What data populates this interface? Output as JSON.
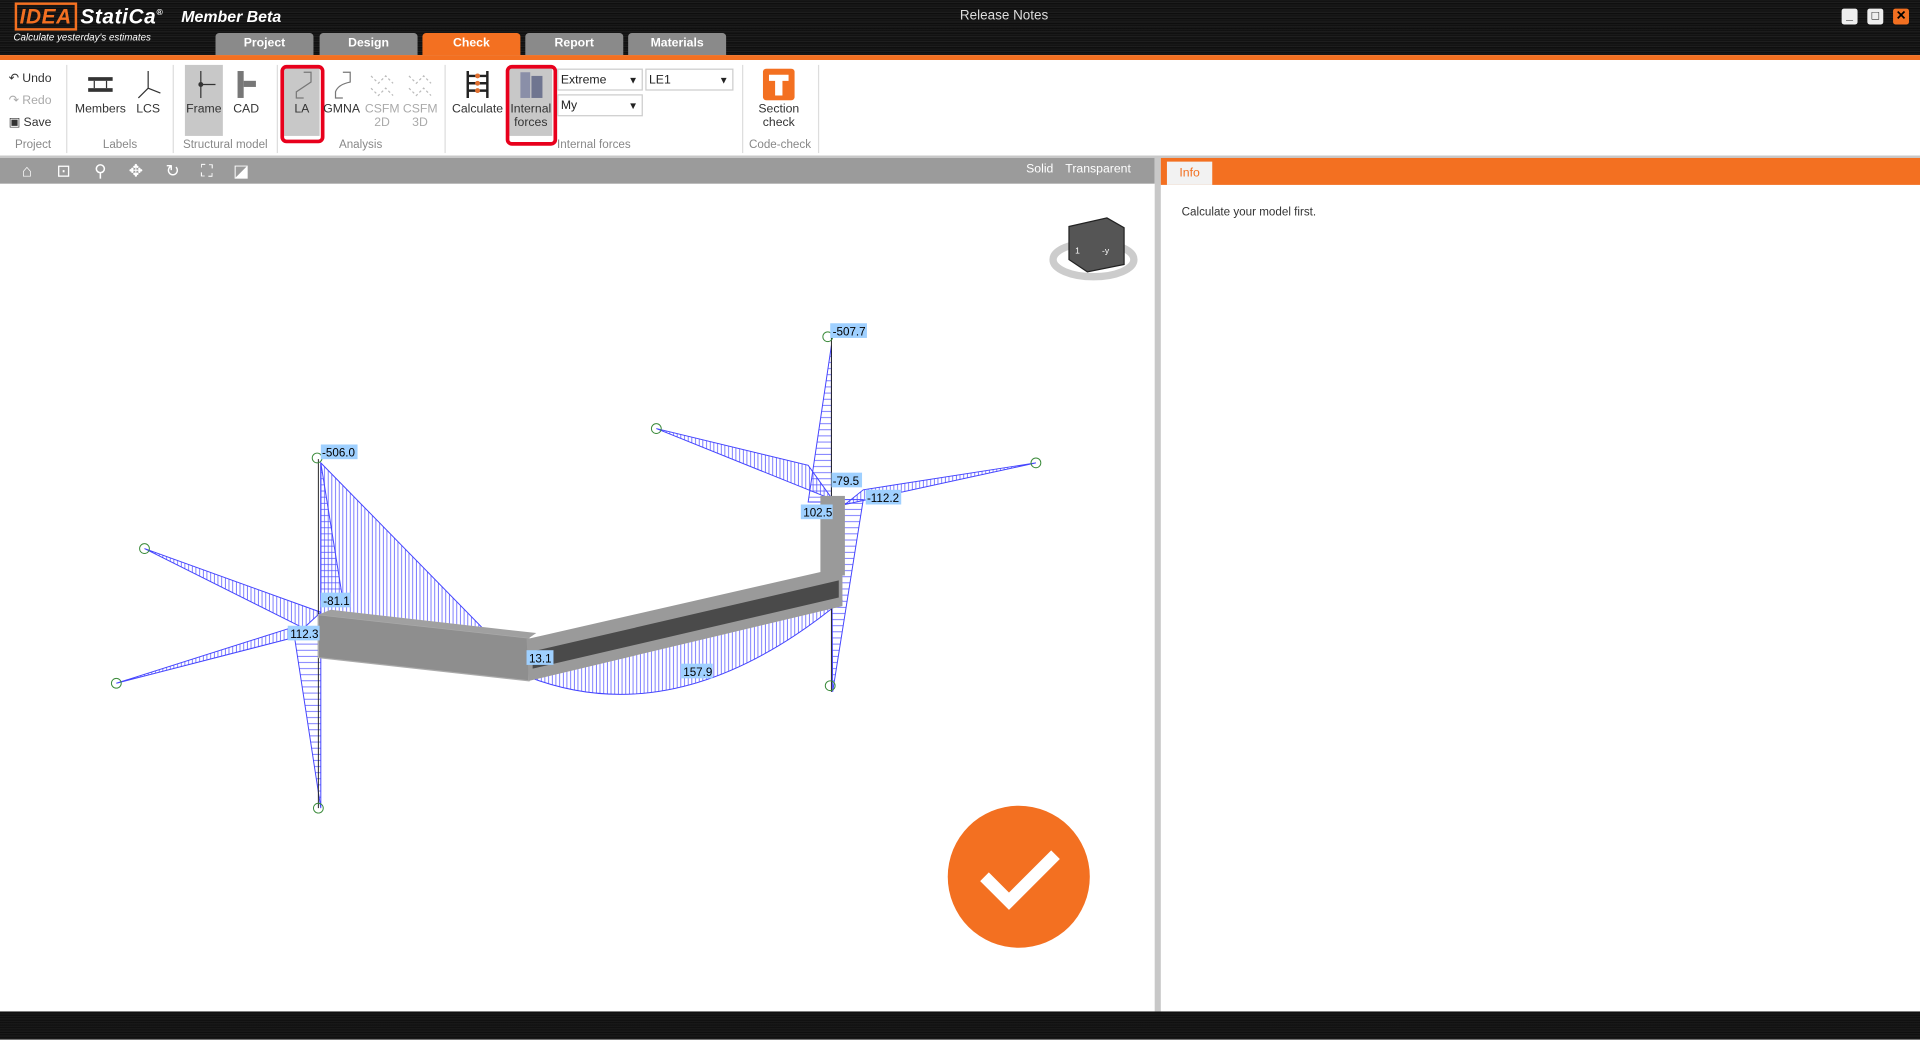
{
  "titlebar": {
    "brand": "IDEA",
    "brand_rest": "StatiCa",
    "registered": "®",
    "product": "Member Beta",
    "tagline": "Calculate yesterday's estimates",
    "window_title": "Release Notes",
    "minimize": "_",
    "maximize": "□",
    "close": "✕"
  },
  "tabs": [
    {
      "label": "Project"
    },
    {
      "label": "Design"
    },
    {
      "label": "Check",
      "active": true
    },
    {
      "label": "Report"
    },
    {
      "label": "Materials"
    }
  ],
  "ribbon": {
    "project": {
      "undo": "Undo",
      "redo": "Redo",
      "save": "Save",
      "group": "Project"
    },
    "labels": {
      "members": "Members",
      "lcs": "LCS",
      "group": "Labels"
    },
    "structural_model": {
      "frame": "Frame",
      "cad": "CAD",
      "group": "Structural model"
    },
    "analysis": {
      "la": "LA",
      "gmna": "GMNA",
      "csfm2d": "CSFM 2D",
      "csfm3d": "CSFM 3D",
      "group": "Analysis"
    },
    "internal_forces": {
      "calculate": "Calculate",
      "internal_forces": "Internal forces",
      "extreme": "Extreme",
      "load": "LE1",
      "component": "My",
      "group": "Internal forces"
    },
    "code_check": {
      "section_check": "Section check",
      "group": "Code-check"
    }
  },
  "viewbar": {
    "solid": "Solid",
    "transparent": "Transparent"
  },
  "info": {
    "tab": "Info",
    "message": "Calculate your model first."
  },
  "diagram_labels": {
    "l1": "-507.7",
    "l2": "-506.0",
    "l3": "-81.1",
    "l4": "112.3",
    "l5": "13.1",
    "l6": "157.9",
    "l7": "102.5",
    "l8": "-79.5",
    "l9": "-112.2"
  },
  "navcube": {
    "face1": "1",
    "face2": "-y"
  },
  "colors": {
    "accent": "#f37021",
    "diagram": "#4444ff",
    "label_bg": "#9fd0ff",
    "highlight": "#e8001c"
  }
}
